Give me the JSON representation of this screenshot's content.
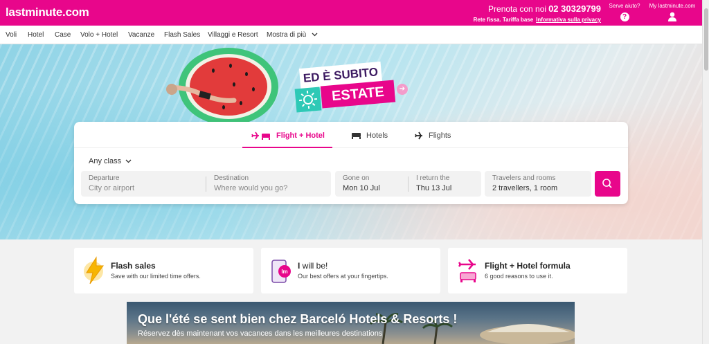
{
  "header": {
    "logo": "lastminute.com",
    "contact_prefix": "Prenota con noi",
    "phone": "02 30329799",
    "line2": "Rete fissa. Tariffa base",
    "privacy_link": "Informativa sulla privacy",
    "help_label": "Serve aiuto?",
    "help_icon": "?",
    "account_label": "My lastminute.com"
  },
  "nav": {
    "items": [
      "Voli",
      "Hotel",
      "Case",
      "Volo + Hotel",
      "Vacanze",
      "Flash Sales",
      "Villaggi e Resort"
    ],
    "more": "Mostra di più"
  },
  "hero": {
    "line1": "ED È SUBITO",
    "line2": "ESTATE"
  },
  "search": {
    "tabs": [
      "Flight + Hotel",
      "Hotels",
      "Flights"
    ],
    "active_tab": 0,
    "class_select": "Any class",
    "departure_label": "Departure",
    "departure_placeholder": "City or airport",
    "destination_label": "Destination",
    "destination_placeholder": "Where would you go?",
    "gone_label": "Gone on",
    "gone_value": "Mon 10 Jul",
    "return_label": "I return the",
    "return_value": "Thu 13 Jul",
    "travelers_label": "Travelers and rooms",
    "travelers_value": "2 travellers, 1 room"
  },
  "features": [
    {
      "title": "Flash sales",
      "subtitle": "Save with our limited time offers."
    },
    {
      "title_bold": "I",
      "title_rest": " will be!",
      "subtitle": "Our best offers at your fingertips.",
      "icon_text": "lm"
    },
    {
      "title": "Flight + Hotel formula",
      "subtitle": "6 good reasons to use it."
    }
  ],
  "banner": {
    "title": "Que l'été se sent bien chez Barceló Hotels & Resorts !",
    "subtitle": "Réservez dès maintenant vos vacances dans les meilleures destinations"
  },
  "colors": {
    "brand": "#e8068b",
    "accent_teal": "#2ec9b6",
    "deep_purple": "#3c1a61"
  }
}
